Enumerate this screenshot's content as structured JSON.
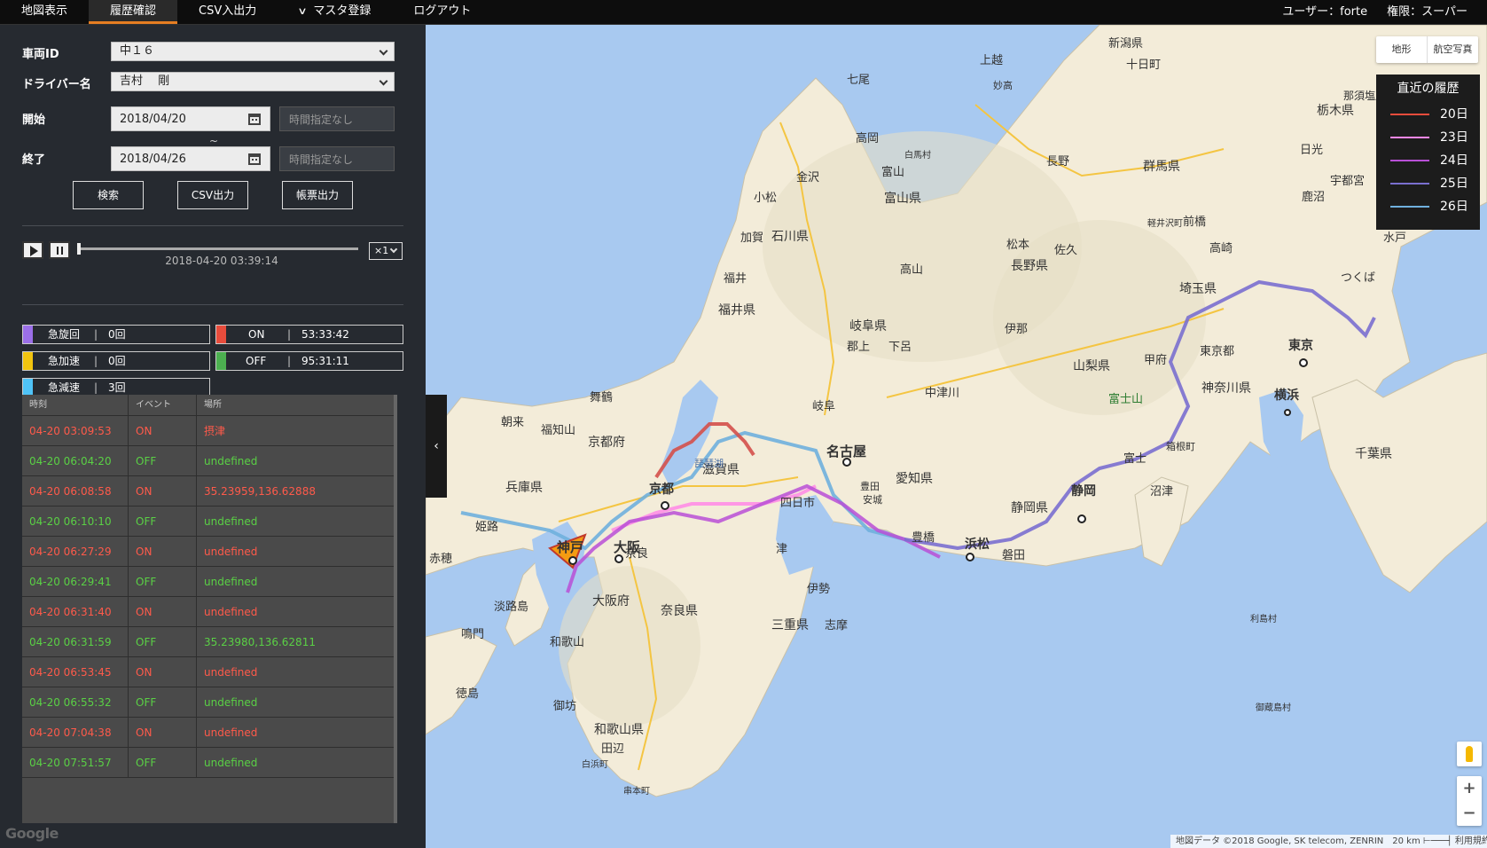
{
  "nav": {
    "items": [
      {
        "label": "地図表示"
      },
      {
        "label": "履歴確認"
      },
      {
        "label": "CSV入出力"
      },
      {
        "label": "マスタ登録"
      },
      {
        "label": "ログアウト"
      }
    ],
    "user": "ユーザー：forte",
    "authority": "権限：スーパー"
  },
  "form": {
    "vehicle_label": "車両ID",
    "vehicle_value": "中１６",
    "driver_label": "ドライバー名",
    "driver_value": "吉村　 剛",
    "start_label": "開始",
    "start_date": "2018/04/20",
    "start_time_placeholder": "時間指定なし",
    "end_label": "終了",
    "end_date": "2018/04/26",
    "end_time_placeholder": "時間指定なし",
    "tilde": "~",
    "search_label": "検索",
    "csv_label": "CSV出力",
    "report_label": "帳票出力"
  },
  "player": {
    "speed": "×1",
    "timestamp": "2018-04-20 03:39:14",
    "progress": 0
  },
  "stats": [
    {
      "label": "急旋回",
      "value": "0回",
      "color": "#9b6fe8"
    },
    {
      "label": "急加速",
      "value": "0回",
      "color": "#f1c40f"
    },
    {
      "label": "急減速",
      "value": "3回",
      "color": "#4fc3f7"
    },
    {
      "label": "ON",
      "value": "53:33:42",
      "color": "#e74c3c"
    },
    {
      "label": "OFF",
      "value": "95:31:11",
      "color": "#4caf50"
    }
  ],
  "table": {
    "headers": [
      "時刻",
      "イベント",
      "場所"
    ],
    "rows": [
      {
        "time": "04-20 03:09:53",
        "event": "ON",
        "place": "摂津"
      },
      {
        "time": "04-20 06:04:20",
        "event": "OFF",
        "place": "undefined"
      },
      {
        "time": "04-20 06:08:58",
        "event": "ON",
        "place": "35.23959,136.62888"
      },
      {
        "time": "04-20 06:10:10",
        "event": "OFF",
        "place": "undefined"
      },
      {
        "time": "04-20 06:27:29",
        "event": "ON",
        "place": "undefined"
      },
      {
        "time": "04-20 06:29:41",
        "event": "OFF",
        "place": "undefined"
      },
      {
        "time": "04-20 06:31:40",
        "event": "ON",
        "place": "undefined"
      },
      {
        "time": "04-20 06:31:59",
        "event": "OFF",
        "place": "35.23980,136.62811"
      },
      {
        "time": "04-20 06:53:45",
        "event": "ON",
        "place": "undefined"
      },
      {
        "time": "04-20 06:55:32",
        "event": "OFF",
        "place": "undefined"
      },
      {
        "time": "04-20 07:04:38",
        "event": "ON",
        "place": "undefined"
      },
      {
        "time": "04-20 07:51:57",
        "event": "OFF",
        "place": "undefined"
      }
    ]
  },
  "map": {
    "maptype_terrain": "地形",
    "maptype_satellite": "航空写真",
    "legend_title": "直近の履歴",
    "legend": [
      {
        "label": "20日",
        "color": "#e74c3c"
      },
      {
        "label": "23日",
        "color": "#ff88e6"
      },
      {
        "label": "24日",
        "color": "#b84fd6"
      },
      {
        "label": "25日",
        "color": "#7a6fcf"
      },
      {
        "label": "26日",
        "color": "#6fb0dd"
      }
    ],
    "labels": [
      {
        "text": "新潟県"
      },
      {
        "text": "十日町"
      },
      {
        "text": "七尾"
      },
      {
        "text": "高岡"
      },
      {
        "text": "富山"
      },
      {
        "text": "富山県"
      },
      {
        "text": "金沢"
      },
      {
        "text": "石川県"
      },
      {
        "text": "長野"
      },
      {
        "text": "長野県"
      },
      {
        "text": "群馬県"
      },
      {
        "text": "栃木県"
      },
      {
        "text": "福井"
      },
      {
        "text": "福井県"
      },
      {
        "text": "岐阜県"
      },
      {
        "text": "高山"
      },
      {
        "text": "松本"
      },
      {
        "text": "埼玉県"
      },
      {
        "text": "東京"
      },
      {
        "text": "横浜"
      },
      {
        "text": "千葉県"
      },
      {
        "text": "山梨県"
      },
      {
        "text": "神奈川県"
      },
      {
        "text": "富士山"
      },
      {
        "text": "静岡"
      },
      {
        "text": "静岡県"
      },
      {
        "text": "浜松"
      },
      {
        "text": "名古屋"
      },
      {
        "text": "愛知県"
      },
      {
        "text": "滋賀県"
      },
      {
        "text": "京都"
      },
      {
        "text": "京都府"
      },
      {
        "text": "大阪"
      },
      {
        "text": "大阪府"
      },
      {
        "text": "神戸"
      },
      {
        "text": "兵庫県"
      },
      {
        "text": "奈良県"
      },
      {
        "text": "三重県"
      },
      {
        "text": "和歌山県"
      },
      {
        "text": "和歌山"
      },
      {
        "text": "津"
      },
      {
        "text": "舞鶴"
      },
      {
        "text": "姫路"
      },
      {
        "text": "田辺"
      },
      {
        "text": "つくば"
      },
      {
        "text": "甲府"
      },
      {
        "text": "沼津"
      },
      {
        "text": "豊橋"
      },
      {
        "text": "岐阜"
      },
      {
        "text": "琵琶湖"
      },
      {
        "text": "四日市"
      },
      {
        "text": "伊勢"
      },
      {
        "text": "日光"
      },
      {
        "text": "宇都宮"
      },
      {
        "text": "前橋"
      },
      {
        "text": "高崎"
      },
      {
        "text": "水戸"
      },
      {
        "text": "鹿沼"
      },
      {
        "text": "佐久"
      },
      {
        "text": "上越"
      },
      {
        "text": "鳴門"
      },
      {
        "text": "徳島"
      },
      {
        "text": "御坊"
      },
      {
        "text": "淡路島"
      },
      {
        "text": "赤穂"
      },
      {
        "text": "福知山"
      },
      {
        "text": "小松"
      },
      {
        "text": "加賀"
      },
      {
        "text": "郡上"
      },
      {
        "text": "下呂"
      },
      {
        "text": "中津川"
      },
      {
        "text": "伊那"
      },
      {
        "text": "富士"
      },
      {
        "text": "磐田"
      },
      {
        "text": "安城"
      },
      {
        "text": "豊田"
      },
      {
        "text": "奈良"
      },
      {
        "text": "志摩"
      },
      {
        "text": "串本町"
      },
      {
        "text": "白浜町"
      },
      {
        "text": "妙高"
      },
      {
        "text": "那須塩原"
      },
      {
        "text": "軽井沢町"
      },
      {
        "text": "白馬村"
      },
      {
        "text": "朝来"
      },
      {
        "text": "東京都"
      },
      {
        "text": "箱根町"
      },
      {
        "text": "御蔵島村"
      },
      {
        "text": "利島村"
      }
    ],
    "attribution": "地図データ ©2018 Google, SK telecom, ZENRIN　20 km ⊢───┤ 利用規約",
    "google_logo": "Google"
  }
}
